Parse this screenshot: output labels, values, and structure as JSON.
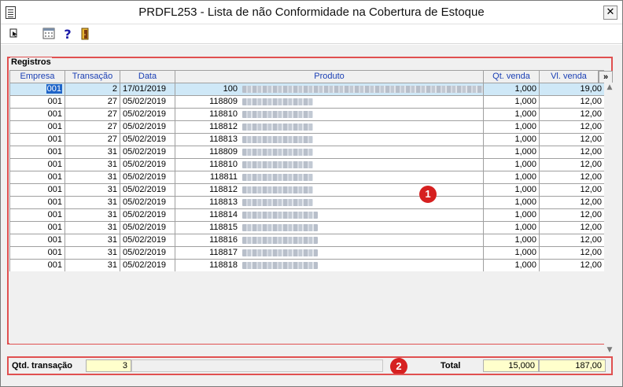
{
  "window": {
    "title": "PRDFL253 - Lista de não Conformidade na Cobertura de Estoque",
    "close_glyph": "✕"
  },
  "toolbar": {
    "icons": [
      "exit-icon",
      "calendar-icon",
      "help-icon",
      "door-icon"
    ]
  },
  "group": {
    "title": "Registros"
  },
  "table": {
    "columns": [
      "Empresa",
      "Transação",
      "Data",
      "Produto",
      "Qt. venda",
      "Vl. venda"
    ],
    "more_label": "»",
    "rows": [
      {
        "empresa": "001",
        "transacao": "2",
        "data": "17/01/2019",
        "produto": "100",
        "qt": "1,000",
        "vl": "19,00"
      },
      {
        "empresa": "001",
        "transacao": "27",
        "data": "05/02/2019",
        "produto": "118809",
        "qt": "1,000",
        "vl": "12,00"
      },
      {
        "empresa": "001",
        "transacao": "27",
        "data": "05/02/2019",
        "produto": "118810",
        "qt": "1,000",
        "vl": "12,00"
      },
      {
        "empresa": "001",
        "transacao": "27",
        "data": "05/02/2019",
        "produto": "118812",
        "qt": "1,000",
        "vl": "12,00"
      },
      {
        "empresa": "001",
        "transacao": "27",
        "data": "05/02/2019",
        "produto": "118813",
        "qt": "1,000",
        "vl": "12,00"
      },
      {
        "empresa": "001",
        "transacao": "31",
        "data": "05/02/2019",
        "produto": "118809",
        "qt": "1,000",
        "vl": "12,00"
      },
      {
        "empresa": "001",
        "transacao": "31",
        "data": "05/02/2019",
        "produto": "118810",
        "qt": "1,000",
        "vl": "12,00"
      },
      {
        "empresa": "001",
        "transacao": "31",
        "data": "05/02/2019",
        "produto": "118811",
        "qt": "1,000",
        "vl": "12,00"
      },
      {
        "empresa": "001",
        "transacao": "31",
        "data": "05/02/2019",
        "produto": "118812",
        "qt": "1,000",
        "vl": "12,00"
      },
      {
        "empresa": "001",
        "transacao": "31",
        "data": "05/02/2019",
        "produto": "118813",
        "qt": "1,000",
        "vl": "12,00"
      },
      {
        "empresa": "001",
        "transacao": "31",
        "data": "05/02/2019",
        "produto": "118814",
        "qt": "1,000",
        "vl": "12,00"
      },
      {
        "empresa": "001",
        "transacao": "31",
        "data": "05/02/2019",
        "produto": "118815",
        "qt": "1,000",
        "vl": "12,00"
      },
      {
        "empresa": "001",
        "transacao": "31",
        "data": "05/02/2019",
        "produto": "118816",
        "qt": "1,000",
        "vl": "12,00"
      },
      {
        "empresa": "001",
        "transacao": "31",
        "data": "05/02/2019",
        "produto": "118817",
        "qt": "1,000",
        "vl": "12,00"
      },
      {
        "empresa": "001",
        "transacao": "31",
        "data": "05/02/2019",
        "produto": "118818",
        "qt": "1,000",
        "vl": "12,00"
      }
    ]
  },
  "footer": {
    "qtd_label": "Qtd. transação",
    "qtd_value": "3",
    "total_label": "Total",
    "total_qt": "15,000",
    "total_vl": "187,00"
  },
  "markers": [
    "1",
    "2"
  ],
  "colors": {
    "highlight_border": "#e05050",
    "marker": "#d62020",
    "header_text": "#1a3fb4",
    "selection": "#cfe8f7",
    "field_bg": "#ffffcc"
  }
}
